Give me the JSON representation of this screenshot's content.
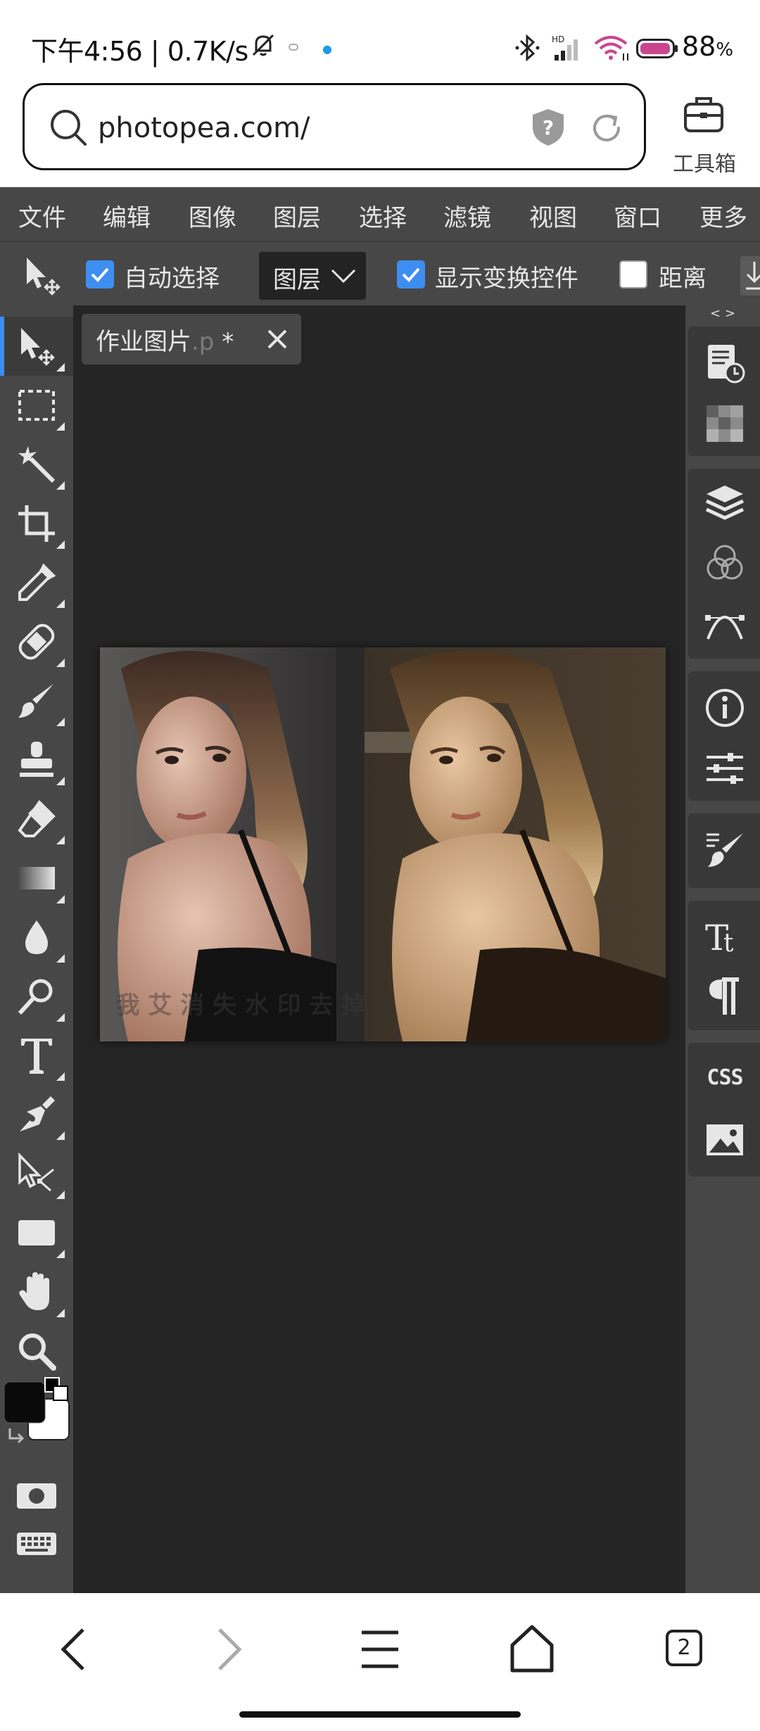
{
  "status_bar": {
    "time_speed": "下午4:56 | 0.7K/s",
    "network_badge": "HD",
    "battery_value": "88",
    "battery_unit": "%",
    "icons": [
      "bell-off-icon",
      "bluetooth-icon",
      "cell-signal-icon",
      "wifi-icon",
      "battery-icon"
    ]
  },
  "browser": {
    "url": "photopea.com/",
    "toolbox_label": "工具箱",
    "icons": [
      "search-icon",
      "security-shield-icon",
      "reload-icon",
      "toolbox-icon"
    ]
  },
  "menu": {
    "items": [
      "文件",
      "编辑",
      "图像",
      "图层",
      "选择",
      "滤镜",
      "视图",
      "窗口",
      "更多"
    ]
  },
  "options_bar": {
    "auto_select_label": "自动选择",
    "auto_select_checked": true,
    "layer_select_value": "图层",
    "show_transform_label": "显示变换控件",
    "show_transform_checked": true,
    "distance_label": "距离",
    "distance_checked": false
  },
  "document": {
    "tab_name": "作业图片",
    "tab_ext": ".p",
    "tab_modified": " *"
  },
  "image": {
    "watermark_text": "我 艾 消 失 水 印 去 掉",
    "description_panels": [
      "before",
      "after"
    ]
  },
  "tools": [
    "move-tool",
    "marquee-tool",
    "magic-wand-tool",
    "crop-tool",
    "eyedropper-tool",
    "healing-brush-tool",
    "brush-tool",
    "clone-stamp-tool",
    "eraser-tool",
    "gradient-tool",
    "blur-tool",
    "dodge-tool",
    "type-tool",
    "pen-tool",
    "path-select-tool",
    "rectangle-tool",
    "hand-tool",
    "zoom-tool"
  ],
  "colors": {
    "foreground": "#0a0a0a",
    "background": "#ffffff",
    "accent": "#3d8ef0",
    "panel": "#474747",
    "workspace": "#252525"
  },
  "right_panel": {
    "css_label": "CSS",
    "collapse_label": "< >"
  },
  "nav": {
    "tab_count": "2"
  }
}
